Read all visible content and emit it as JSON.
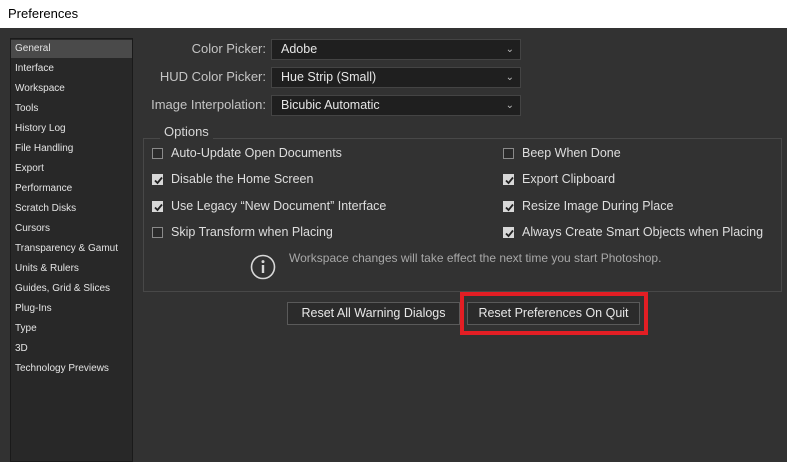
{
  "window": {
    "title": "Preferences"
  },
  "sidebar": {
    "items": [
      {
        "label": "General",
        "selected": true
      },
      {
        "label": "Interface"
      },
      {
        "label": "Workspace"
      },
      {
        "label": "Tools"
      },
      {
        "label": "History Log"
      },
      {
        "label": "File Handling"
      },
      {
        "label": "Export"
      },
      {
        "label": "Performance"
      },
      {
        "label": "Scratch Disks"
      },
      {
        "label": "Cursors"
      },
      {
        "label": "Transparency & Gamut"
      },
      {
        "label": "Units & Rulers"
      },
      {
        "label": "Guides, Grid & Slices"
      },
      {
        "label": "Plug-Ins"
      },
      {
        "label": "Type"
      },
      {
        "label": "3D"
      },
      {
        "label": "Technology Previews"
      }
    ]
  },
  "settings": {
    "color_picker": {
      "label": "Color Picker:",
      "value": "Adobe"
    },
    "hud_color_picker": {
      "label": "HUD Color Picker:",
      "value": "Hue Strip (Small)"
    },
    "image_interpolation": {
      "label": "Image Interpolation:",
      "value": "Bicubic Automatic"
    }
  },
  "options": {
    "legend": "Options",
    "left": [
      {
        "label": "Auto-Update Open Documents",
        "checked": false
      },
      {
        "label": "Disable the Home Screen",
        "checked": true
      },
      {
        "label": "Use Legacy “New Document” Interface",
        "checked": true
      },
      {
        "label": "Skip Transform when Placing",
        "checked": false
      }
    ],
    "right": [
      {
        "label": "Beep When Done",
        "checked": false
      },
      {
        "label": "Export Clipboard",
        "checked": true
      },
      {
        "label": "Resize Image During Place",
        "checked": true
      },
      {
        "label": "Always Create Smart Objects when Placing",
        "checked": true
      }
    ],
    "info": "Workspace changes will take effect the next time you start Photoshop."
  },
  "buttons": {
    "reset_warnings": "Reset All Warning Dialogs",
    "reset_prefs": "Reset Preferences On Quit"
  },
  "colors": {
    "highlight": "#e31e24",
    "background": "#323232"
  }
}
